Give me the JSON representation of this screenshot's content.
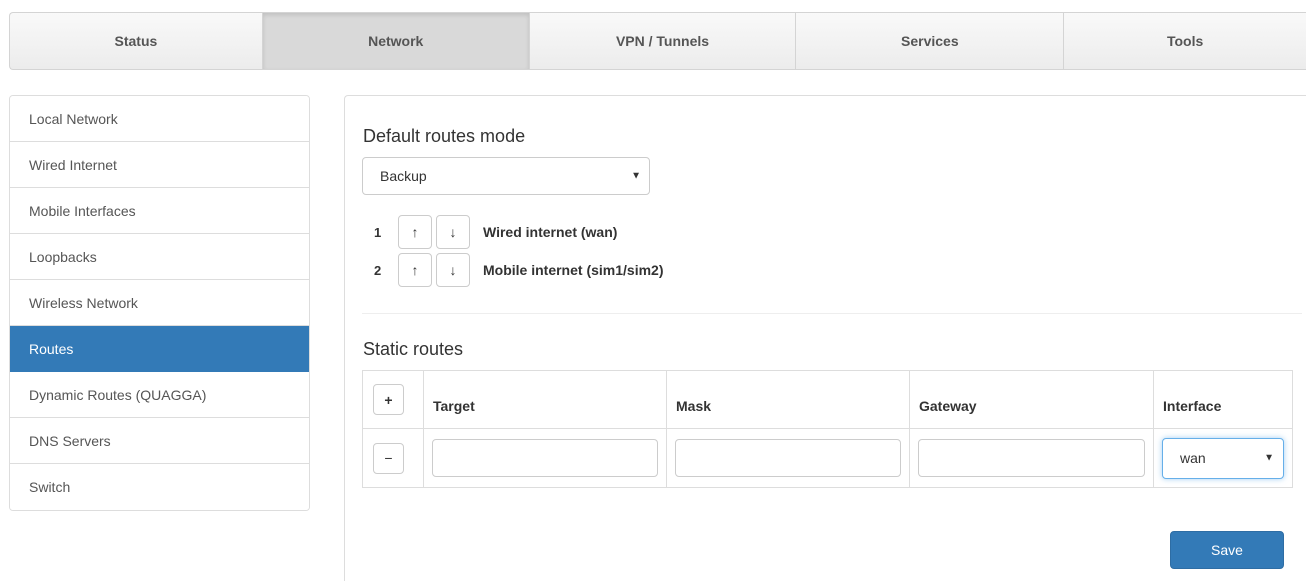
{
  "topnav": {
    "tabs": [
      {
        "label": "Status"
      },
      {
        "label": "Network"
      },
      {
        "label": "VPN / Tunnels"
      },
      {
        "label": "Services"
      },
      {
        "label": "Tools"
      }
    ],
    "active": "Network"
  },
  "sidebar": {
    "items": [
      {
        "label": "Local Network"
      },
      {
        "label": "Wired Internet"
      },
      {
        "label": "Mobile Interfaces"
      },
      {
        "label": "Loopbacks"
      },
      {
        "label": "Wireless Network"
      },
      {
        "label": "Routes"
      },
      {
        "label": "Dynamic Routes (QUAGGA)"
      },
      {
        "label": "DNS Servers"
      },
      {
        "label": "Switch"
      }
    ],
    "active": "Routes"
  },
  "default_routes": {
    "title": "Default routes mode",
    "mode_selected": "Backup",
    "priority": [
      {
        "num": "1",
        "up": "↑",
        "down": "↓",
        "label": "Wired internet (wan)"
      },
      {
        "num": "2",
        "up": "↑",
        "down": "↓",
        "label": "Mobile internet (sim1/sim2)"
      }
    ]
  },
  "static_routes": {
    "title": "Static routes",
    "add_label": "+",
    "remove_label": "−",
    "columns": {
      "target": "Target",
      "mask": "Mask",
      "gateway": "Gateway",
      "interface": "Interface"
    },
    "row": {
      "target": "",
      "mask": "",
      "gateway": "",
      "interface": "wan"
    }
  },
  "save_label": "Save",
  "colors": {
    "accent": "#337ab7"
  },
  "icons": {
    "caret": "caret-down-icon",
    "arrow_up": "arrow-up-icon",
    "arrow_down": "arrow-down-icon"
  }
}
